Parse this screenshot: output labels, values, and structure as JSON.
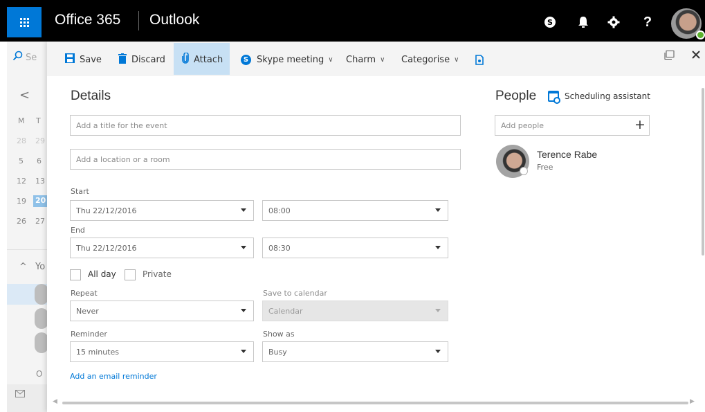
{
  "topbar": {
    "brand": "Office 365",
    "app_name": "Outlook",
    "icons": [
      "waffle-icon",
      "skype-icon",
      "bell-icon",
      "gear-icon",
      "help-icon"
    ],
    "help_label": "?"
  },
  "leftpane": {
    "search_partial": "Se",
    "prev_label": "<",
    "weekdays": [
      "M",
      "T"
    ],
    "mini_rows": [
      [
        "28",
        "29"
      ],
      [
        "5",
        "6"
      ],
      [
        "12",
        "13"
      ],
      [
        "19",
        "20"
      ],
      [
        "26",
        "27"
      ]
    ],
    "selected_day": "20",
    "section_partial": "Yo",
    "bottom_partial": "O"
  },
  "toolbar": {
    "save": "Save",
    "discard": "Discard",
    "attach": "Attach",
    "skype_meeting": "Skype meeting",
    "charm": "Charm",
    "categorise": "Categorise"
  },
  "details": {
    "heading": "Details",
    "title_placeholder": "Add a title for the event",
    "location_placeholder": "Add a location or a room",
    "start_label": "Start",
    "start_date": "Thu 22/12/2016",
    "start_time": "08:00",
    "end_label": "End",
    "end_date": "Thu 22/12/2016",
    "end_time": "08:30",
    "all_day": "All day",
    "private": "Private",
    "repeat_label": "Repeat",
    "repeat_value": "Never",
    "save_to_calendar_label": "Save to calendar",
    "save_to_calendar_value": "Calendar",
    "reminder_label": "Reminder",
    "reminder_value": "15 minutes",
    "show_as_label": "Show as",
    "show_as_value": "Busy",
    "email_reminder_link": "Add an email reminder"
  },
  "people": {
    "heading": "People",
    "scheduling_assistant": "Scheduling assistant",
    "add_people_placeholder": "Add people",
    "attendees": [
      {
        "name": "Terence Rabe",
        "status": "Free"
      }
    ]
  },
  "colors": {
    "accent": "#0078d7",
    "topbar_bg": "#000000",
    "attach_highlight": "#c7e0f4",
    "mini_selected": "#8fc1e8",
    "presence_available": "#5bb12d"
  }
}
